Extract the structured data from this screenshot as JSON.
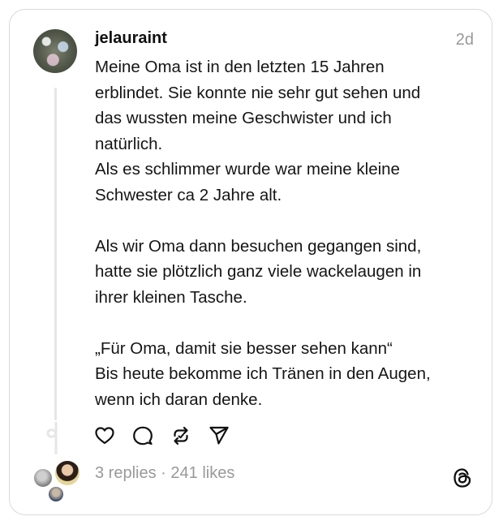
{
  "post": {
    "username": "jelauraint",
    "time": "2d",
    "text": "Meine Oma ist in den letzten 15 Jahren\nerblindet. Sie konnte nie sehr gut sehen und\ndas wussten meine Geschwister und ich\nnatürlich.\nAls es schlimmer wurde war meine kleine\nSchwester ca 2 Jahre alt.\n\nAls wir Oma dann besuchen gegangen sind,\nhatte sie plötzlich ganz viele wackelaugen in\nihrer kleinen Tasche.\n\n„Für Oma, damit sie besser sehen kann“\nBis heute bekomme ich Tränen in den Augen,\nwenn ich daran denke."
  },
  "stats": {
    "replies": "3 replies",
    "separator": " · ",
    "likes": "241 likes"
  },
  "icons": {
    "like": "heart-icon",
    "reply": "comment-icon",
    "repost": "repost-icon",
    "share": "send-icon",
    "brand": "threads-logo-icon"
  },
  "colors": {
    "text": "#101010",
    "muted": "#999999",
    "border": "#d9d9d9",
    "thread_line": "#e6e6e6"
  }
}
